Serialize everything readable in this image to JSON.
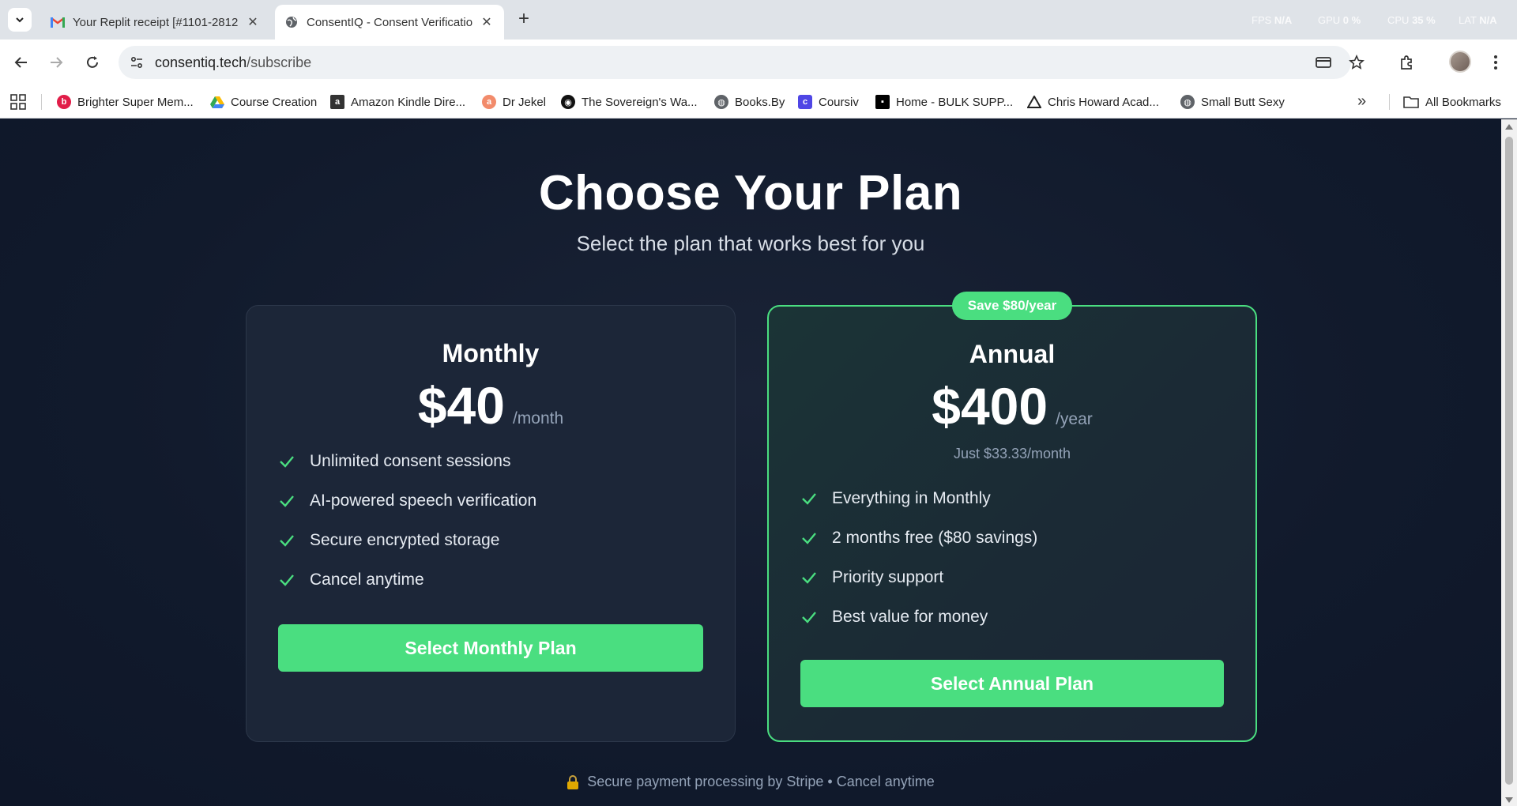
{
  "browser": {
    "tabs": [
      {
        "title": "Your Replit receipt [#1101-2812",
        "icon": "gmail-icon"
      },
      {
        "title": "ConsentIQ - Consent Verificatio",
        "icon": "globe-icon"
      }
    ],
    "perf": {
      "fps_label": "FPS",
      "fps_value": "N/A",
      "gpu_label": "GPU",
      "gpu_value": "0 %",
      "cpu_label": "CPU",
      "cpu_value": "35 %",
      "lat_label": "LAT",
      "lat_value": "N/A"
    },
    "url_domain": "consentiq.tech",
    "url_path": "/subscribe",
    "bookmarks": [
      {
        "label": "Brighter Super Mem...",
        "color": "#e11d48"
      },
      {
        "label": "Course Creation",
        "color": "#fbbc04"
      },
      {
        "label": "Amazon Kindle Dire...",
        "color": "#333333"
      },
      {
        "label": "Dr Jekel",
        "color": "#f28b6b"
      },
      {
        "label": "The Sovereign's Wa...",
        "color": "#111111"
      },
      {
        "label": "Books.By",
        "color": "#5f6368"
      },
      {
        "label": "Coursiv",
        "color": "#4f46e5"
      },
      {
        "label": "Home - BULK SUPP...",
        "color": "#000000"
      },
      {
        "label": "Chris Howard Acad...",
        "color": "#222222"
      },
      {
        "label": "Small Butt Sexy",
        "color": "#5f6368"
      }
    ],
    "all_bookmarks": "All Bookmarks"
  },
  "page": {
    "title": "Choose Your Plan",
    "subtitle": "Select the plan that works best for you",
    "monthly": {
      "name": "Monthly",
      "price": "$40",
      "period": "/month",
      "features": [
        "Unlimited consent sessions",
        "AI-powered speech verification",
        "Secure encrypted storage",
        "Cancel anytime"
      ],
      "button": "Select Monthly Plan"
    },
    "annual": {
      "badge": "Save $80/year",
      "name": "Annual",
      "price": "$400",
      "period": "/year",
      "per_month": "Just $33.33/month",
      "features": [
        "Everything in Monthly",
        "2 months free ($80 savings)",
        "Priority support",
        "Best value for money"
      ],
      "button": "Select Annual Plan"
    },
    "footer": "Secure payment processing by Stripe • Cancel anytime"
  },
  "colors": {
    "accent": "#4ade80",
    "background": "#0f172a",
    "card": "#1c2638",
    "muted": "#94a3b8"
  }
}
